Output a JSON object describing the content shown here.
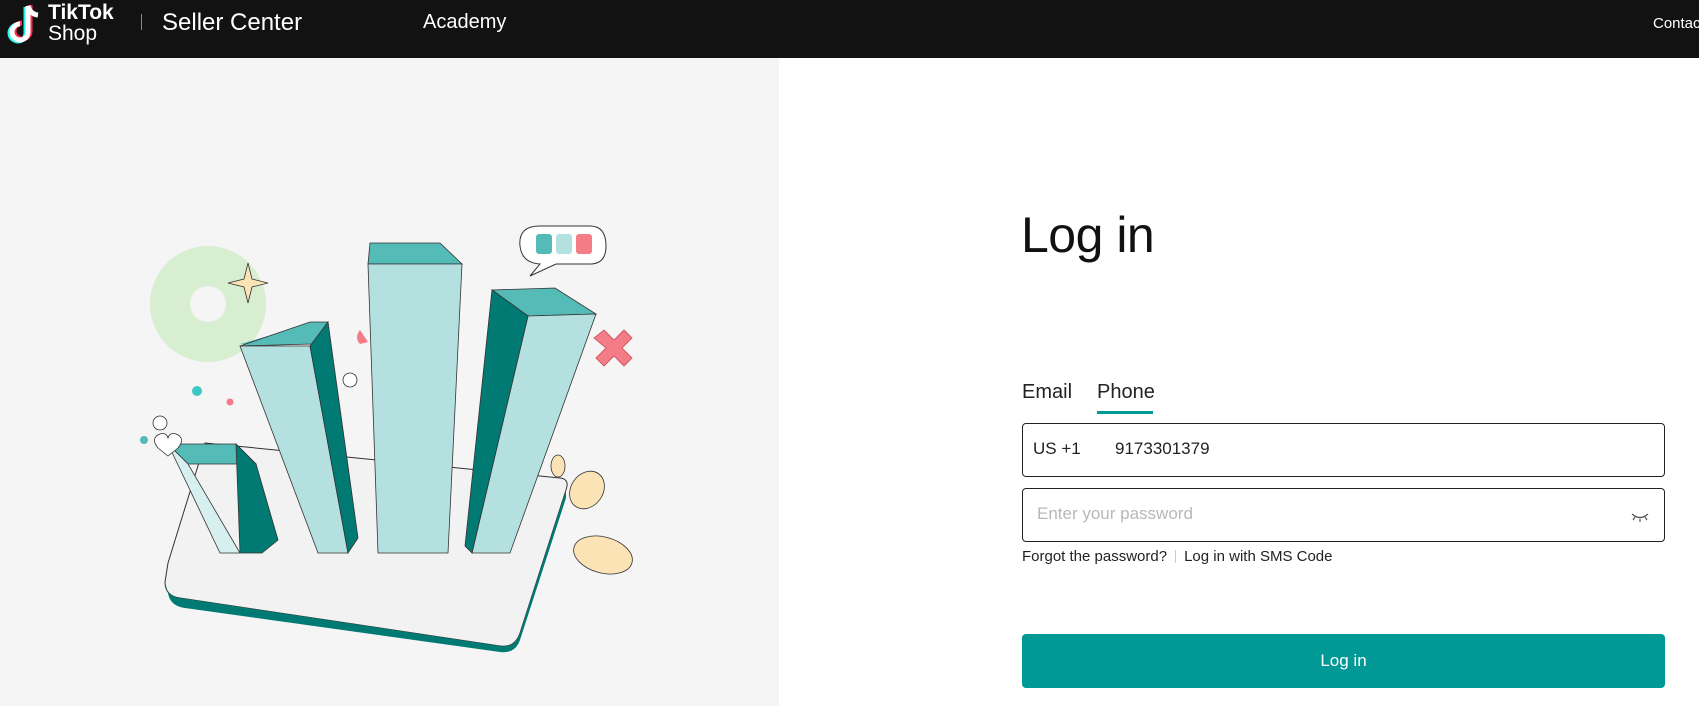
{
  "header": {
    "logo_line1": "TikTok",
    "logo_line2": "Shop",
    "product": "Seller Center",
    "nav_academy": "Academy",
    "contact": "Contact"
  },
  "login": {
    "title": "Log in",
    "tabs": [
      {
        "label": "Email",
        "active": false
      },
      {
        "label": "Phone",
        "active": true
      }
    ],
    "country_code": "US +1",
    "phone_value": "9173301379",
    "password_placeholder": "Enter your password",
    "forgot_label": "Forgot the password?",
    "sms_label": "Log in with SMS Code",
    "submit_label": "Log in"
  },
  "icons": {
    "logo": "tiktok-logo-icon",
    "eye": "eye-closed-icon"
  },
  "colors": {
    "accent": "#009995",
    "topbar": "#121212",
    "panel": "#f5f5f5"
  }
}
